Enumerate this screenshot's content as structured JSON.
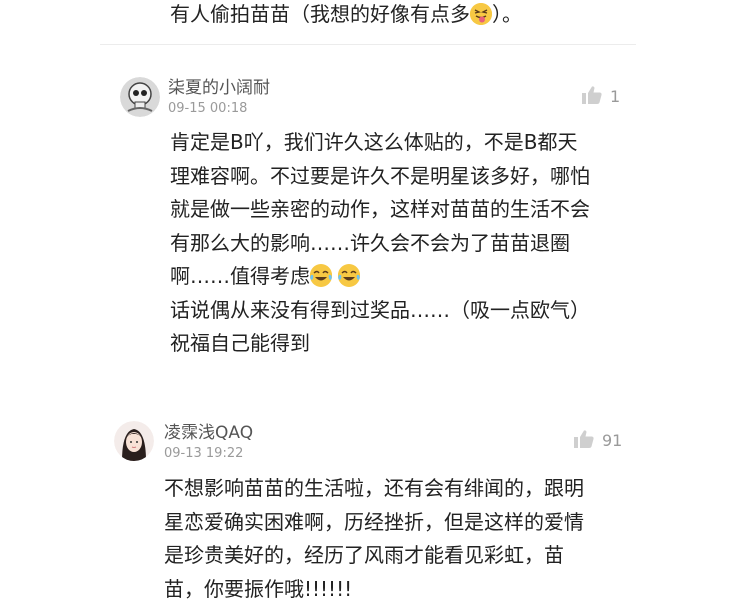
{
  "top_comment": {
    "text": "有人偷拍苗苗（我想的好像有点多",
    "text_after": "）。",
    "emoji": "tongue-emoji"
  },
  "comments": [
    {
      "username": "柒夏的小阔耐",
      "timestamp": "09-15 00:18",
      "likes": "1",
      "avatar": "skull-avatar",
      "lines": [
        "肯定是B吖，我们许久这么体贴的，不是B都天",
        "理难容啊。不过要是许久不是明星该多好，哪怕",
        "就是做一些亲密的动作，这样对苗苗的生活不会",
        "有那么大的影响……许久会不会为了苗苗退圈",
        "啊……值得考虑",
        "话说偶从来没有得到过奖品……（吸一点欧气）",
        "祝福自己能得到"
      ],
      "line5_emojis": [
        "laughing-crying-emoji",
        "laughing-crying-emoji"
      ]
    },
    {
      "username": "凌霂浅QAQ",
      "timestamp": "09-13 19:22",
      "likes": "91",
      "avatar": "girl-avatar",
      "lines": [
        "不想影响苗苗的生活啦，还有会有绯闻的，跟明",
        "星恋爱确实困难啊，历经挫折，但是这样的爱情",
        "是珍贵美好的，经历了风雨才能看见彩虹，苗",
        "苗，你要振作哦!!!!!!"
      ]
    }
  ],
  "colors": {
    "text": "#222222",
    "username": "#555555",
    "meta": "#9a9a9a",
    "divider": "#ececec",
    "emoji_yellow": "#f7c843"
  }
}
